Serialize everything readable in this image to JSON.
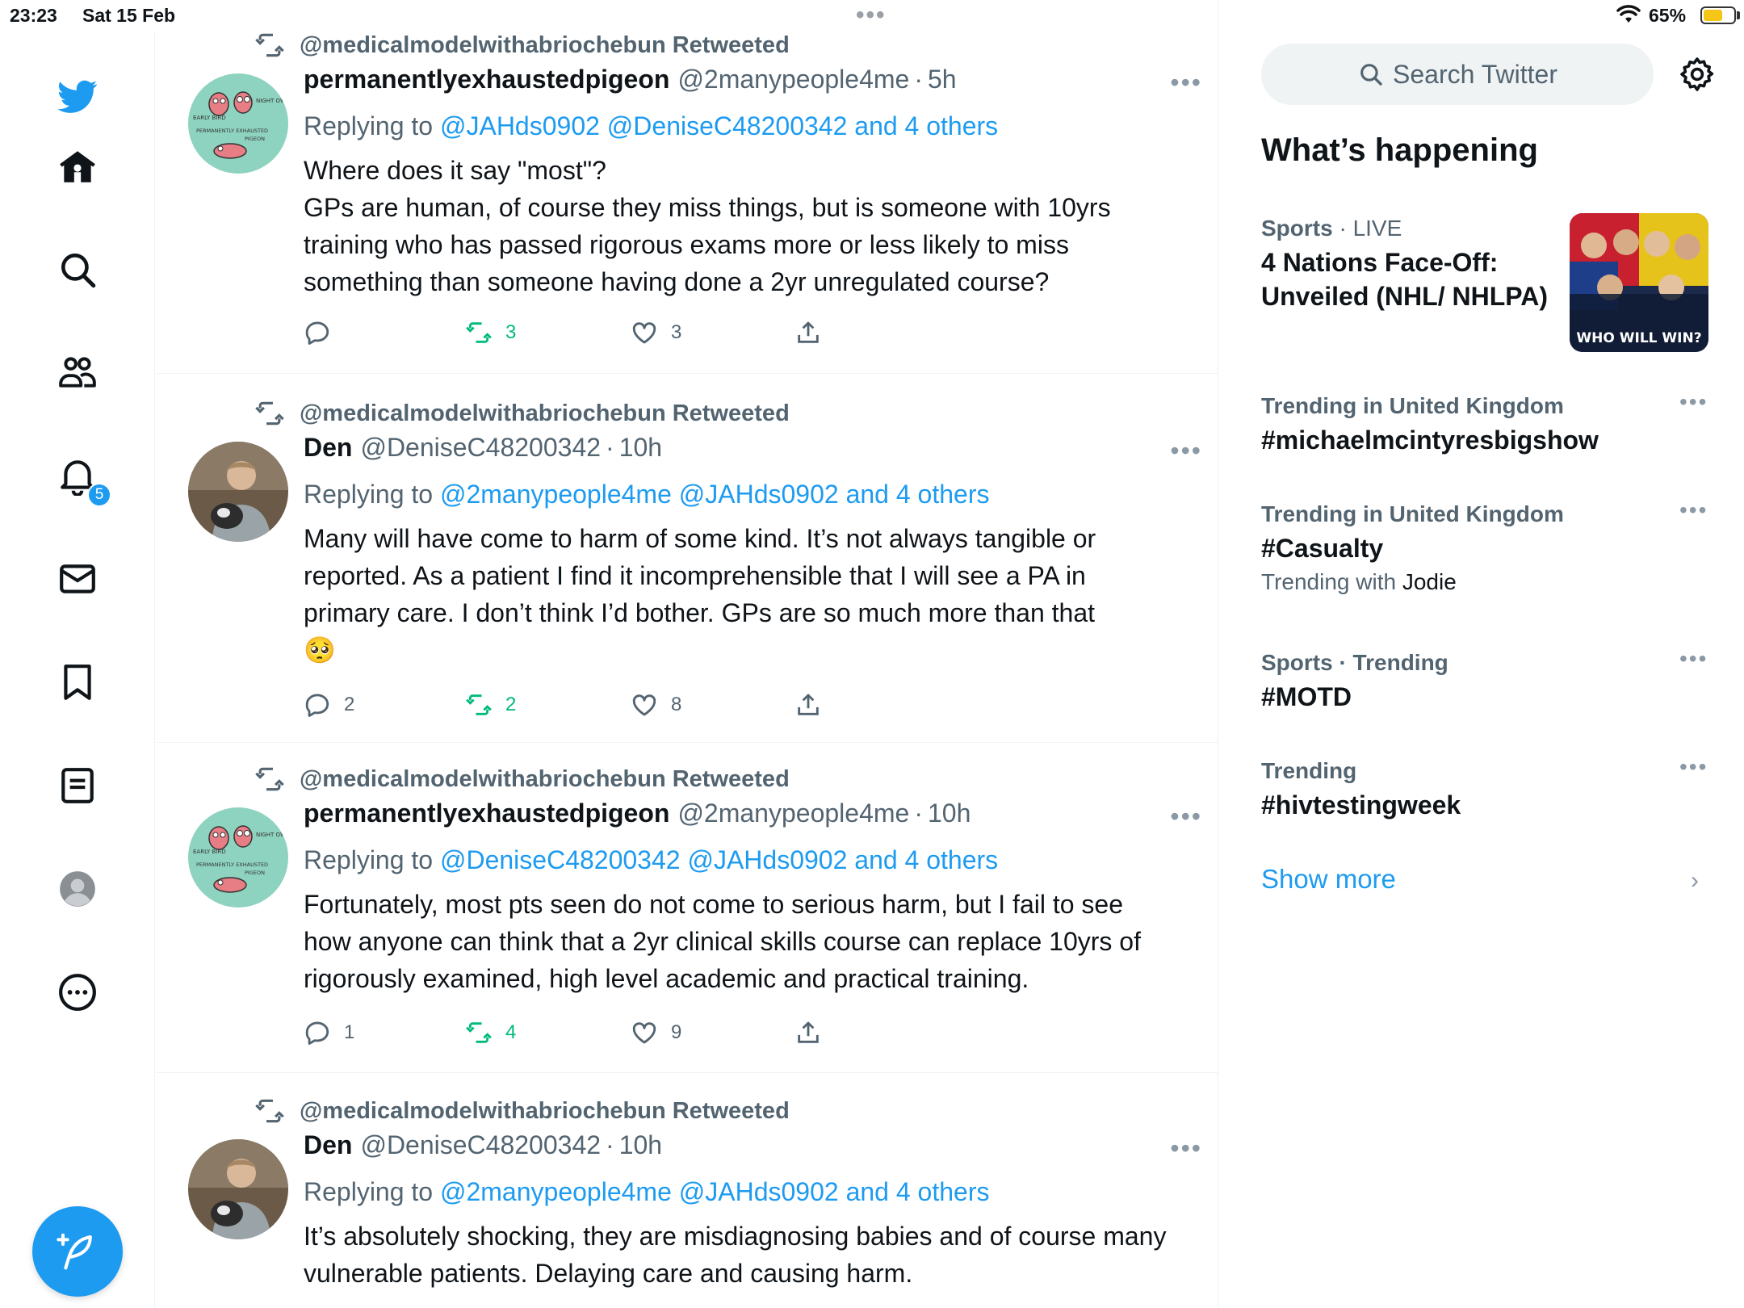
{
  "status_bar": {
    "time": "23:23",
    "date": "Sat 15 Feb",
    "battery": "65%",
    "battery_level": 0.65
  },
  "nav": {
    "notification_count": "5",
    "icons": [
      "twitter-logo-icon",
      "home-icon",
      "search-icon",
      "communities-icon",
      "notifications-icon",
      "messages-icon",
      "bookmarks-icon",
      "lists-icon",
      "profile-icon",
      "more-icon"
    ]
  },
  "tweets": [
    {
      "retweeted_by": "@medicalmodelwithabriochebun Retweeted",
      "name": "permanentlyexhaustedpigeon",
      "handle": "@2manypeople4me",
      "sep": "·",
      "time": "5h",
      "replying_prefix": "Replying to",
      "replying_mentions": "@JAHds0902 @DeniseC48200342 and 4 others",
      "text": "Where does it say \"most\"?\nGPs are human, of course they miss things, but is someone with 10yrs training who has passed rigorous exams more or less likely to miss something than someone having done a 2yr unregulated course?",
      "replies": "",
      "retweets": "3",
      "likes": "3"
    },
    {
      "retweeted_by": "@medicalmodelwithabriochebun Retweeted",
      "name": "Den",
      "handle": "@DeniseC48200342",
      "sep": "·",
      "time": "10h",
      "replying_prefix": "Replying to",
      "replying_mentions": "@2manypeople4me @JAHds0902 and 4 others",
      "text": "Many will have come to harm of some kind. It’s not always tangible or reported. As a patient I find it incomprehensible that I will see a PA in primary care. I don’t think I’d bother. GPs are so much more than that",
      "emoji": "🥺",
      "replies": "2",
      "retweets": "2",
      "likes": "8"
    },
    {
      "retweeted_by": "@medicalmodelwithabriochebun Retweeted",
      "name": "permanentlyexhaustedpigeon",
      "handle": "@2manypeople4me",
      "sep": "·",
      "time": "10h",
      "replying_prefix": "Replying to",
      "replying_mentions": "@DeniseC48200342 @JAHds0902 and 4 others",
      "text": "Fortunately, most pts seen do not come to serious harm, but I fail to see how anyone can think that a 2yr clinical skills course can replace 10yrs of rigorously examined, high level academic and practical training.",
      "replies": "1",
      "retweets": "4",
      "likes": "9"
    },
    {
      "retweeted_by": "@medicalmodelwithabriochebun Retweeted",
      "name": "Den",
      "handle": "@DeniseC48200342",
      "sep": "·",
      "time": "10h",
      "replying_prefix": "Replying to",
      "replying_mentions": "@2manypeople4me @JAHds0902 and 4 others",
      "text": "It’s absolutely shocking, they are misdiagnosing babies and of course many vulnerable patients. Delaying care and causing harm."
    }
  ],
  "avatar_text": {
    "early_bird": "EARLY BIRD",
    "night_owl": "NIGHT OWL",
    "permanently": "PERMANENTLY EXHAUSTED",
    "pigeon": "PIGEON"
  },
  "sidebar": {
    "search_placeholder": "Search Twitter",
    "title": "What’s happening",
    "trends": [
      {
        "category": "Sports",
        "sep": "·",
        "status": "LIVE",
        "name": "4 Nations Face-Off: Unveiled (NHL/ NHLPA)",
        "image_caption": "WHO WILL WIN?"
      },
      {
        "category": "Trending in United Kingdom",
        "name": "#michaelmcintyresbigshow"
      },
      {
        "category": "Trending in United Kingdom",
        "name": "#Casualty",
        "sub_prefix": "Trending with",
        "sub_value": "Jodie"
      },
      {
        "category": "Sports · Trending",
        "name": "#MOTD"
      },
      {
        "category": "Trending",
        "name": "#hivtestingweek"
      }
    ],
    "show_more": "Show more"
  },
  "colors": {
    "accent": "#1d9bf0",
    "retweet_green": "#00ba7c",
    "muted": "#536471"
  }
}
